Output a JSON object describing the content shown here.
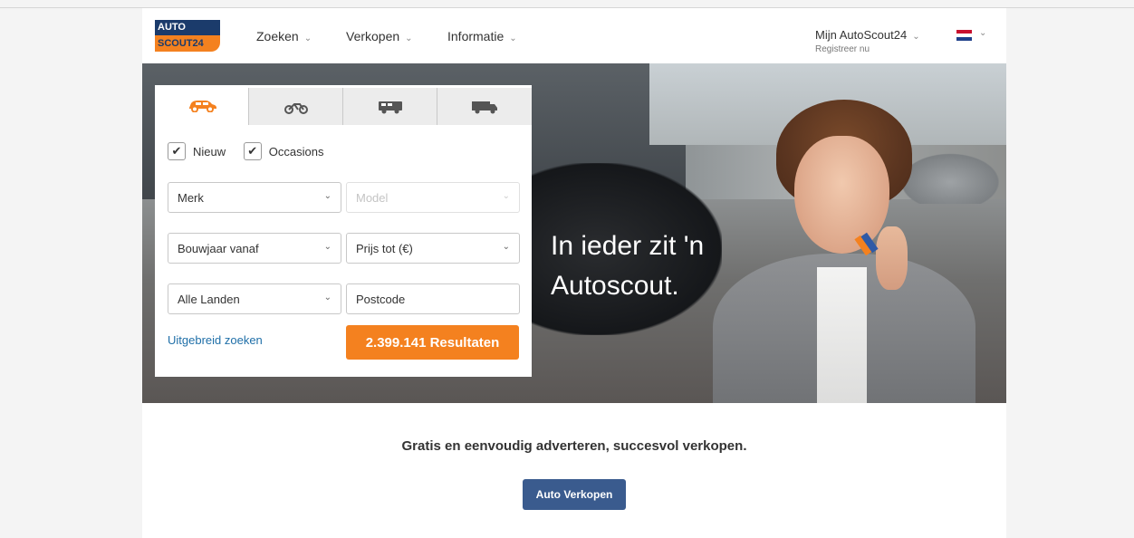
{
  "logo": {
    "line1": "AUTO",
    "line2": "SCOUT24"
  },
  "nav": [
    {
      "label": "Zoeken"
    },
    {
      "label": "Verkopen"
    },
    {
      "label": "Informatie"
    }
  ],
  "account": {
    "label": "Mijn AutoScout24",
    "sub": "Registreer nu"
  },
  "colors": {
    "brand_orange": "#f4811f",
    "brand_blue": "#1b3b6b",
    "link": "#1f6fa8",
    "sell_button": "#3a5b8e"
  },
  "search": {
    "tabs": [
      {
        "icon": "car-icon",
        "active": true
      },
      {
        "icon": "motorcycle-icon",
        "active": false
      },
      {
        "icon": "camper-icon",
        "active": false
      },
      {
        "icon": "truck-icon",
        "active": false
      }
    ],
    "check_new": "Nieuw",
    "check_used": "Occasions",
    "make": "Merk",
    "model": "Model",
    "year": "Bouwjaar vanaf",
    "price": "Prijs tot (€)",
    "country": "Alle Landen",
    "postcode": "Postcode",
    "advanced_link": "Uitgebreid zoeken",
    "results_button": "2.399.141 Resultaten"
  },
  "hero": {
    "slogan_line1": "In ieder zit 'n",
    "slogan_line2": "Autoscout."
  },
  "promo": {
    "text": "Gratis en eenvoudig adverteren, succesvol verkopen.",
    "button": "Auto Verkopen"
  }
}
